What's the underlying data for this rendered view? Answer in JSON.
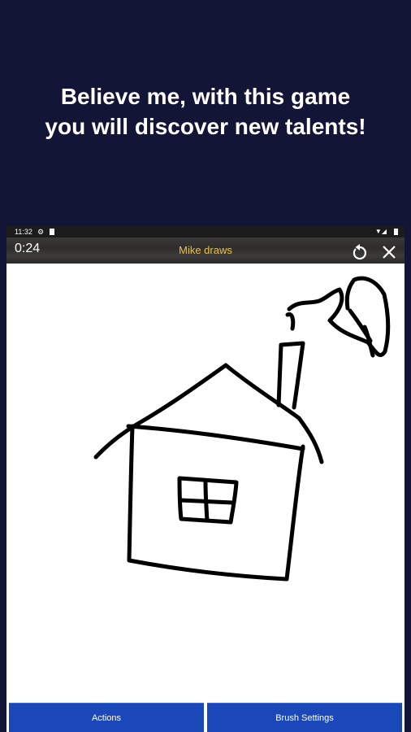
{
  "headline": {
    "line1": "Believe me, with this game",
    "line2": "you will discover new talents!"
  },
  "status_bar": {
    "time": "11:32"
  },
  "game": {
    "timer": "0:24",
    "title": "Mike draws",
    "title_color": "#f2c230"
  },
  "icons": {
    "undo": "undo-icon",
    "close": "close-icon",
    "settings": "gear-icon",
    "wifi": "wifi-icon",
    "battery": "battery-icon"
  },
  "buttons": {
    "actions_label": "Actions",
    "brush_settings_label": "Brush Settings"
  },
  "colors": {
    "background": "#131536",
    "button": "#1a48b8",
    "stroke": "#000000"
  }
}
